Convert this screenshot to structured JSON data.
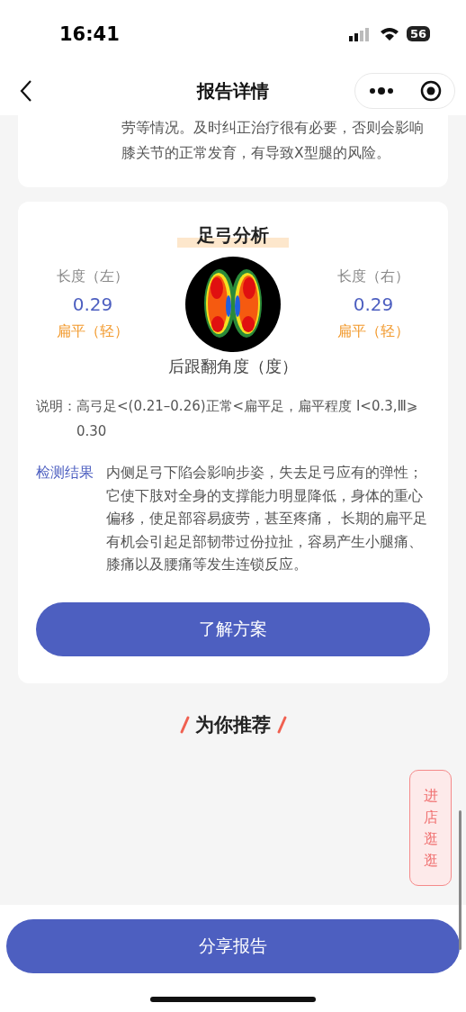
{
  "status_bar": {
    "time": "16:41",
    "battery": "56"
  },
  "nav": {
    "title": "报告详情"
  },
  "previous_card": {
    "lines": [
      "劳等情况。及时纠正治疗很有必要，否则会影响",
      "膝关节的正常发育，有导致X型腿的风险。"
    ]
  },
  "arch_card": {
    "title": "足弓分析",
    "sides": [
      {
        "label": "长度（左）",
        "value": "0.29",
        "grade": "扁平（轻）"
      },
      {
        "label": "长度（右）",
        "value": "0.29",
        "grade": "扁平（轻）"
      }
    ],
    "angle_label": "后跟翻角度（度）",
    "note_label": "说明：",
    "note": "高弓足<(0.21–0.26)正常<扁平足，扁平程度 Ⅰ<0.3,Ⅲ⩾0.30",
    "result_label": "检测结果",
    "result": "内侧足弓下陷会影响步姿，失去足弓应有的弹性；它使下肢对全身的支撑能力明显降低，身体的重心偏移，使足部容易疲劳，甚至疼痛， 长期的扁平足有机会引起足部韧带过份拉扯，容易产生小腿痛、膝痛以及腰痛等发生连锁反应。",
    "button": "了解方案"
  },
  "recommend": {
    "title": "为你推荐"
  },
  "float_button": "进店逛逛",
  "share_button": "分享报告"
}
